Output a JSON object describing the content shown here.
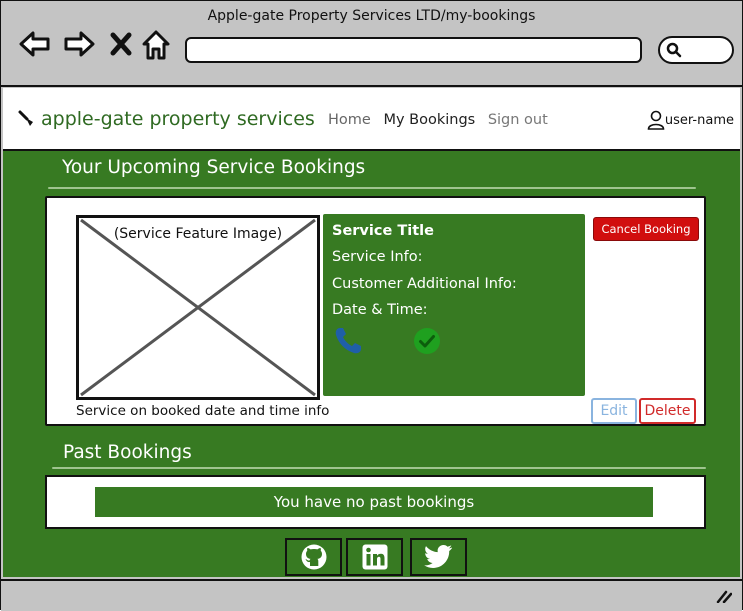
{
  "browser": {
    "title": "Apple-gate Property Services LTD/my-bookings",
    "icons": [
      "back-arrow-icon",
      "forward-arrow-icon",
      "close-icon",
      "home-icon",
      "search-icon"
    ]
  },
  "header": {
    "brand": "apple-gate property services",
    "nav": {
      "home": "Home",
      "my_bookings": "My Bookings",
      "sign_out": "Sign out"
    },
    "user": "user-name"
  },
  "upcoming": {
    "title": "Your Upcoming Service Bookings",
    "image_label": "(Service Feature Image)",
    "caption": "Service on booked date and time info",
    "info": {
      "title": "Service Title",
      "service_info": "Service Info:",
      "additional_info": "Customer Additional Info:",
      "date_time": "Date & Time:"
    },
    "cancel_label": "Cancel Booking",
    "edit_label": "Edit",
    "delete_label": "Delete"
  },
  "past": {
    "title": "Past Bookings",
    "empty_message": "You have no past bookings"
  },
  "social": [
    "github-icon",
    "linkedin-icon",
    "twitter-icon"
  ],
  "colors": {
    "brand_green": "#377a22",
    "cancel_red": "#d10e0e",
    "edit_blue": "#8ab4df",
    "delete_red": "#d12a2a",
    "phone_blue": "#1f5fa8",
    "check_green": "#1fa01f"
  }
}
